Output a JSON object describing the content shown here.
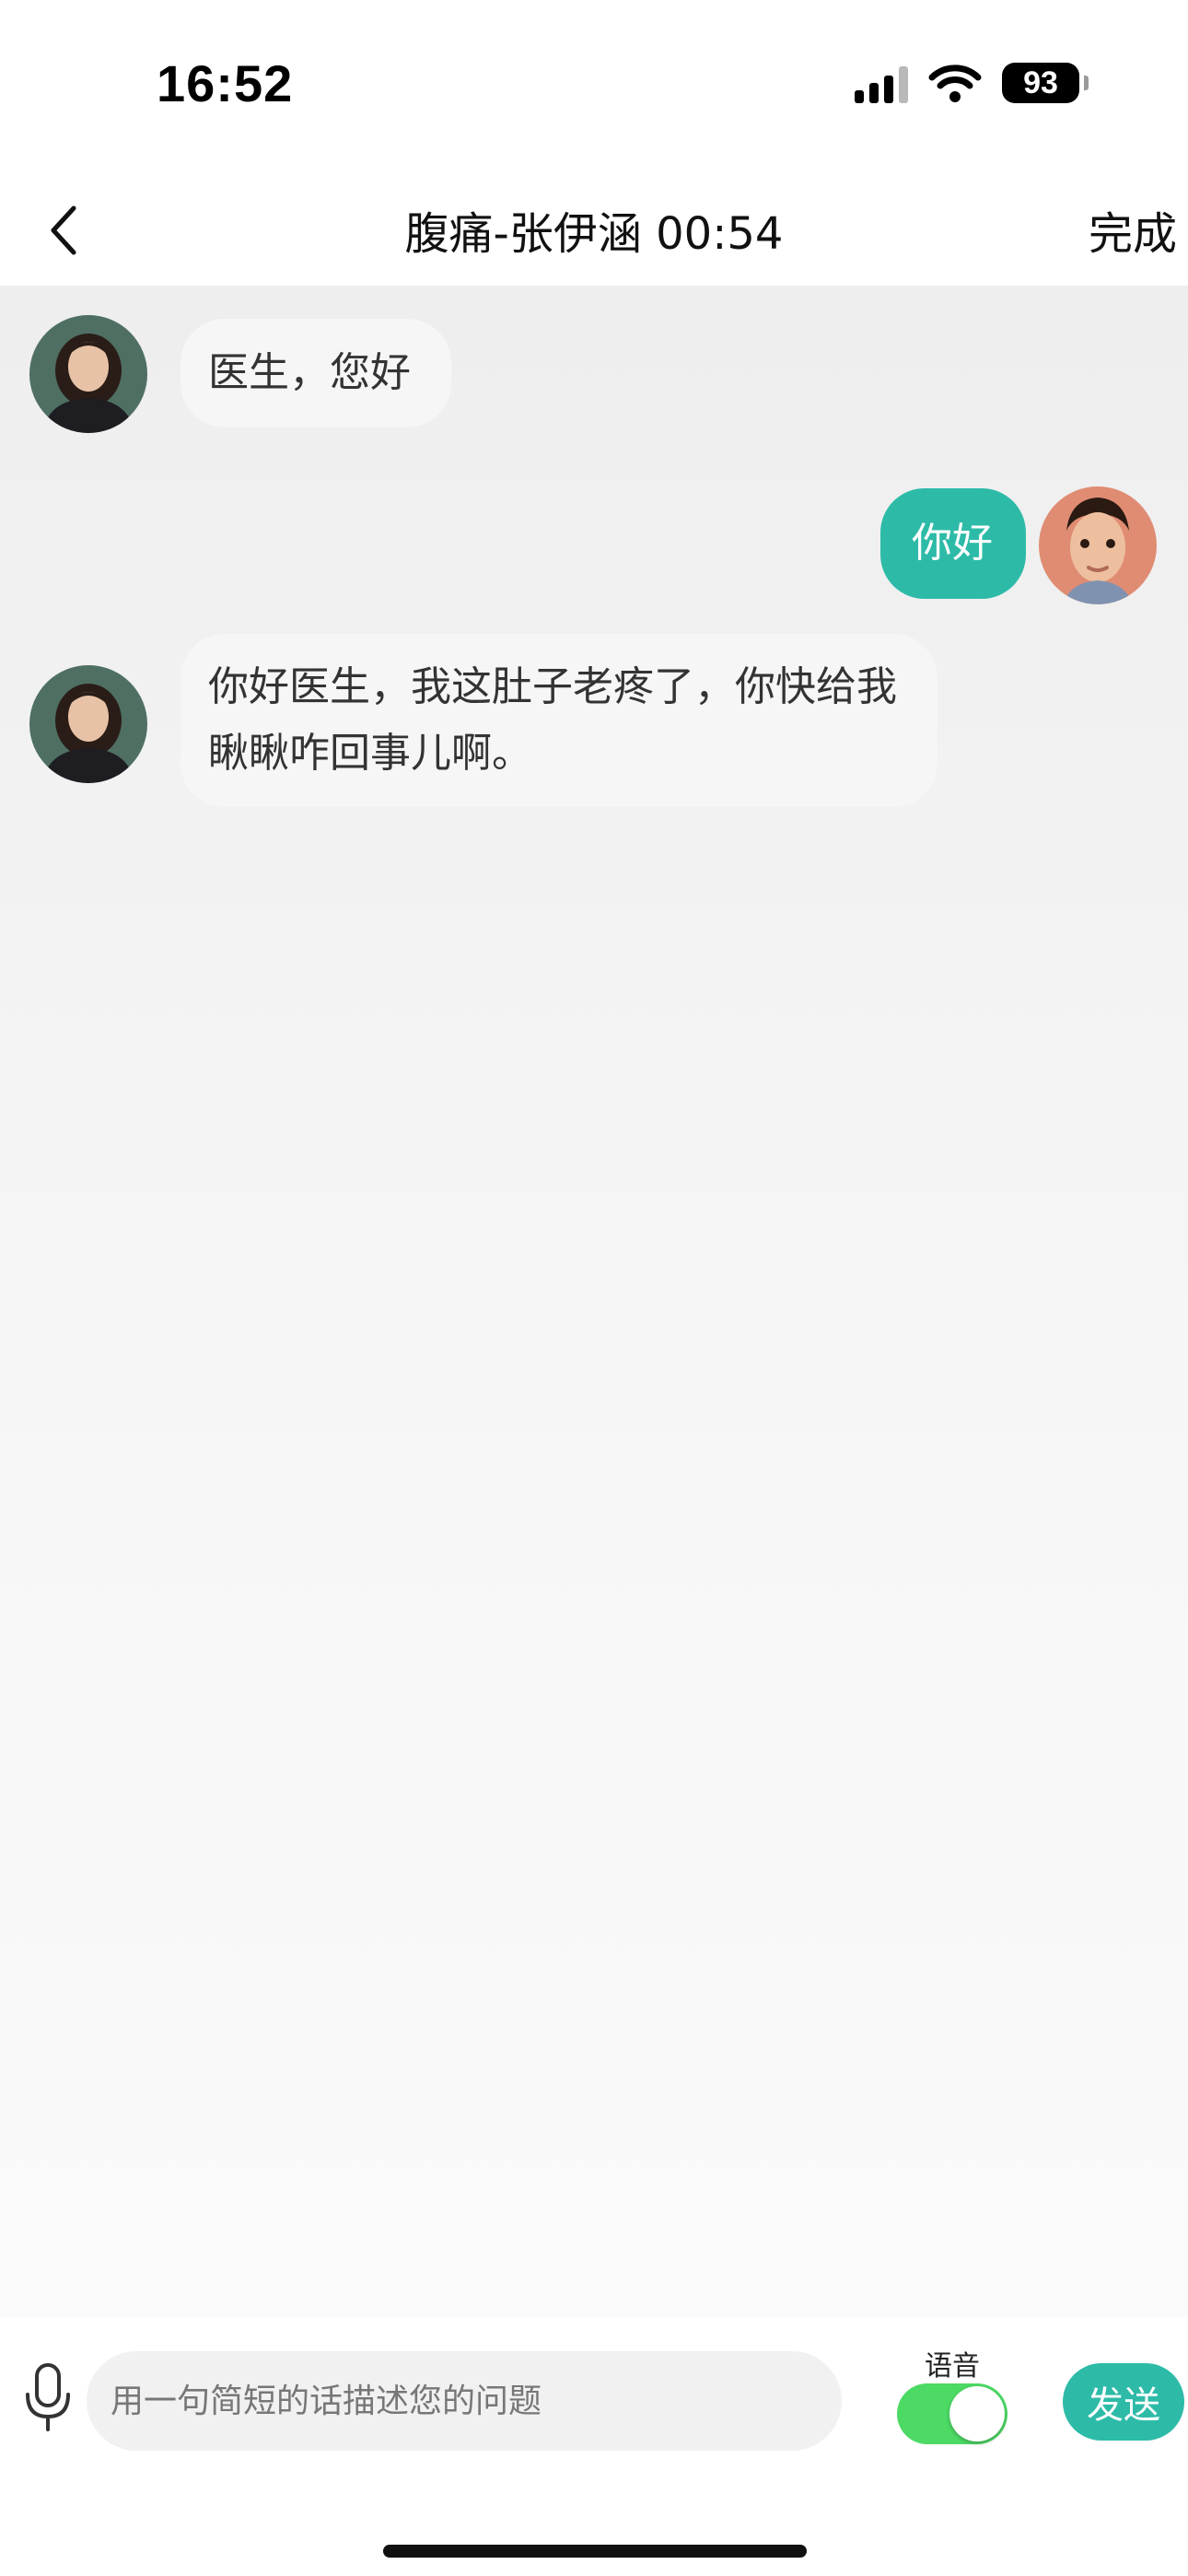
{
  "status_bar": {
    "time": "16:52",
    "battery": "93",
    "icons": [
      "signal-icon",
      "wifi-icon",
      "battery-icon"
    ]
  },
  "nav": {
    "title": "腹痛-张伊涵 00:54",
    "done_label": "完成",
    "back_icon": "chevron-left-icon"
  },
  "messages": [
    {
      "sender": "patient",
      "text": "医生，您好"
    },
    {
      "sender": "user",
      "text": "你好"
    },
    {
      "sender": "patient",
      "text": "你好医生，我这肚子老疼了，你快给我瞅瞅咋回事儿啊。"
    }
  ],
  "input": {
    "placeholder": "用一句简短的话描述您的问题",
    "value": "",
    "voice_label": "语音",
    "voice_enabled": true,
    "send_label": "发送",
    "mic_icon": "microphone-icon"
  },
  "colors": {
    "accent": "#2dbba8",
    "toggle_on": "#4cd964",
    "chat_background": "#eeeeee",
    "incoming_bubble": "#f6f6f6"
  }
}
